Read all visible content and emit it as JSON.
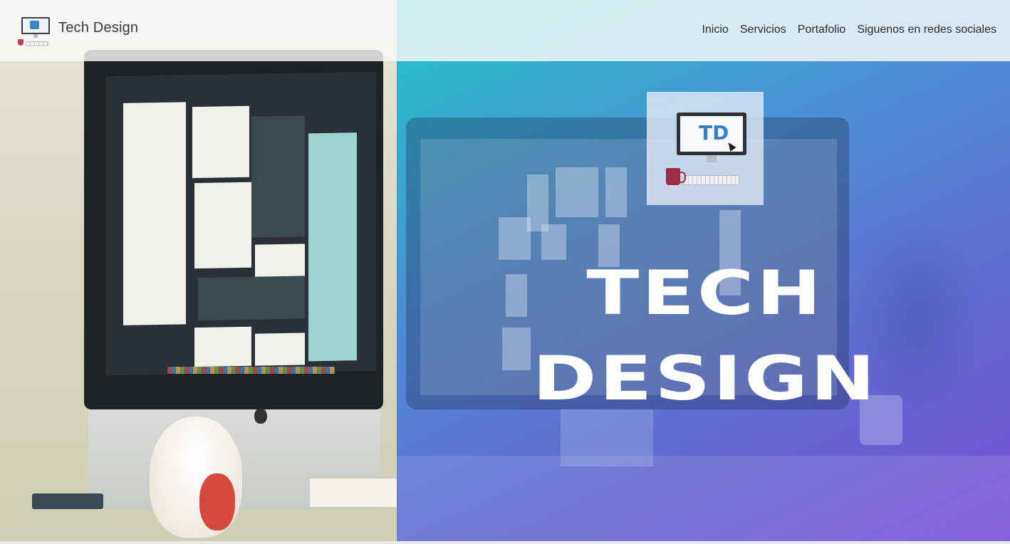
{
  "brand": {
    "name": "Tech Design"
  },
  "nav": {
    "items": [
      "Inicio",
      "Servicios",
      "Portafolio",
      "Siguenos en redes sociales"
    ]
  },
  "hero": {
    "title_line1": "TECH",
    "title_line2": "DESIGN",
    "logo_letters": "TD"
  },
  "colors": {
    "gradient_start": "#22c4c8",
    "gradient_mid": "#4d8ed3",
    "gradient_end": "#7a4fd6",
    "mug": "#9a2e47",
    "logo_letter": "#3a80c7"
  }
}
